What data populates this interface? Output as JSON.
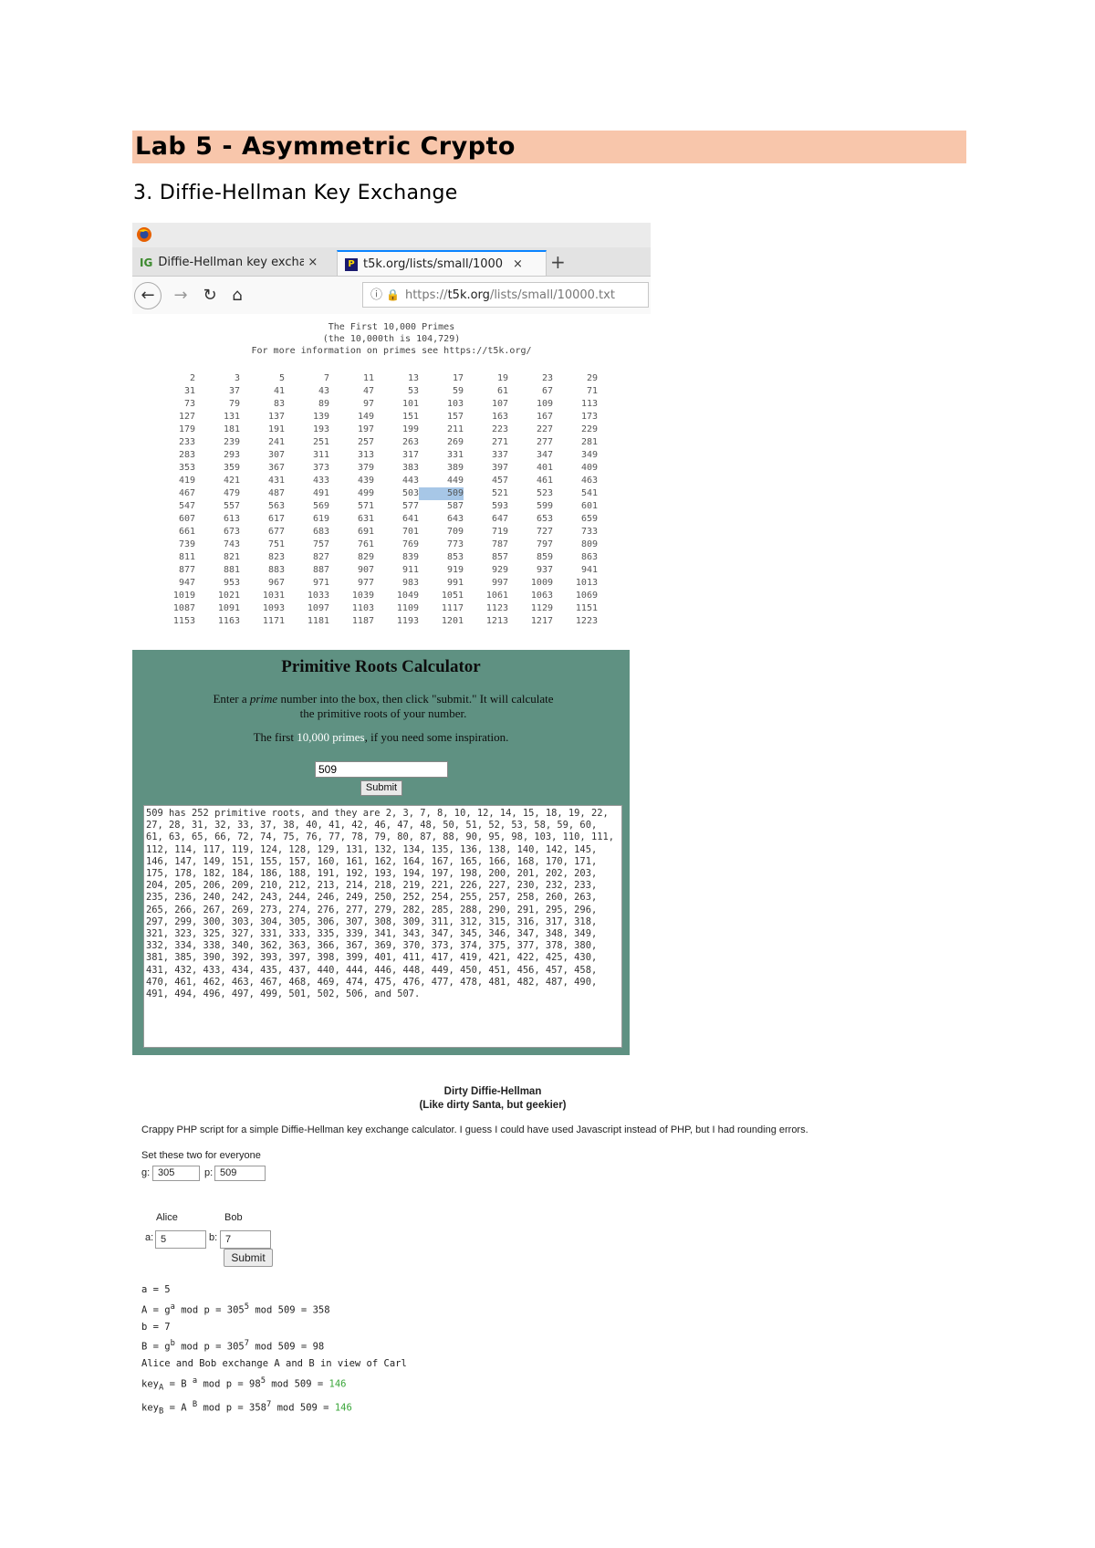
{
  "document": {
    "title": "Lab 5 - Asymmetric Crypto",
    "section": "3. Diffie-Hellman Key Exchange"
  },
  "browser": {
    "tabs": [
      {
        "label": "Diffie-Hellman key excha",
        "favicon": "IG",
        "active": false
      },
      {
        "label": "t5k.org/lists/small/1000",
        "favicon": "P",
        "active": true
      }
    ],
    "close_glyph": "×",
    "new_tab_glyph": "+",
    "url": {
      "prefix": "https://",
      "host": "t5k.org",
      "path": "/lists/small/10000.txt"
    }
  },
  "primes_page": {
    "line1": "The First 10,000 Primes",
    "line2": "(the 10,000th is 104,729)",
    "line3": "For more information on primes see https://t5k.org/",
    "rows": [
      [
        "2",
        "3",
        "5",
        "7",
        "11",
        "13",
        "17",
        "19",
        "23",
        "29"
      ],
      [
        "31",
        "37",
        "41",
        "43",
        "47",
        "53",
        "59",
        "61",
        "67",
        "71"
      ],
      [
        "73",
        "79",
        "83",
        "89",
        "97",
        "101",
        "103",
        "107",
        "109",
        "113"
      ],
      [
        "127",
        "131",
        "137",
        "139",
        "149",
        "151",
        "157",
        "163",
        "167",
        "173"
      ],
      [
        "179",
        "181",
        "191",
        "193",
        "197",
        "199",
        "211",
        "223",
        "227",
        "229"
      ],
      [
        "233",
        "239",
        "241",
        "251",
        "257",
        "263",
        "269",
        "271",
        "277",
        "281"
      ],
      [
        "283",
        "293",
        "307",
        "311",
        "313",
        "317",
        "331",
        "337",
        "347",
        "349"
      ],
      [
        "353",
        "359",
        "367",
        "373",
        "379",
        "383",
        "389",
        "397",
        "401",
        "409"
      ],
      [
        "419",
        "421",
        "431",
        "433",
        "439",
        "443",
        "449",
        "457",
        "461",
        "463"
      ],
      [
        "467",
        "479",
        "487",
        "491",
        "499",
        "503",
        "509",
        "521",
        "523",
        "541"
      ],
      [
        "547",
        "557",
        "563",
        "569",
        "571",
        "577",
        "587",
        "593",
        "599",
        "601"
      ],
      [
        "607",
        "613",
        "617",
        "619",
        "631",
        "641",
        "643",
        "647",
        "653",
        "659"
      ],
      [
        "661",
        "673",
        "677",
        "683",
        "691",
        "701",
        "709",
        "719",
        "727",
        "733"
      ],
      [
        "739",
        "743",
        "751",
        "757",
        "761",
        "769",
        "773",
        "787",
        "797",
        "809"
      ],
      [
        "811",
        "821",
        "823",
        "827",
        "829",
        "839",
        "853",
        "857",
        "859",
        "863"
      ],
      [
        "877",
        "881",
        "883",
        "887",
        "907",
        "911",
        "919",
        "929",
        "937",
        "941"
      ],
      [
        "947",
        "953",
        "967",
        "971",
        "977",
        "983",
        "991",
        "997",
        "1009",
        "1013"
      ],
      [
        "1019",
        "1021",
        "1031",
        "1033",
        "1039",
        "1049",
        "1051",
        "1061",
        "1063",
        "1069"
      ],
      [
        "1087",
        "1091",
        "1093",
        "1097",
        "1103",
        "1109",
        "1117",
        "1123",
        "1129",
        "1151"
      ],
      [
        "1153",
        "1163",
        "1171",
        "1181",
        "1187",
        "1193",
        "1201",
        "1213",
        "1217",
        "1223"
      ]
    ],
    "highlighted": "509"
  },
  "calculator": {
    "heading": "Primitive Roots Calculator",
    "desc_a": "Enter a ",
    "desc_em": "prime",
    "desc_b": " number into the box, then click \"submit.\" It will calculate the primitive roots of your number.",
    "inspire_a": "The first ",
    "inspire_link": "10,000 primes",
    "inspire_b": ", if you need some inspiration.",
    "input_value": "509",
    "submit_label": "Submit",
    "output": "509 has 252 primitive roots, and they are 2, 3, 7, 8, 10, 12, 14, 15, 18, 19, 22, 27, 28, 31, 32, 33, 37, 38, 40, 41, 42, 46, 47, 48, 50, 51, 52, 53, 58, 59, 60, 61, 63, 65, 66, 72, 74, 75, 76, 77, 78, 79, 80, 87, 88, 90, 95, 98, 103, 110, 111, 112, 114, 117, 119, 124, 128, 129, 131, 132, 134, 135, 136, 138, 140, 142, 145, 146, 147, 149, 151, 155, 157, 160, 161, 162, 164, 167, 165, 166, 168, 170, 171, 175, 178, 182, 184, 186, 188, 191, 192, 193, 194, 197, 198, 200, 201, 202, 203, 204, 205, 206, 209, 210, 212, 213, 214, 218, 219, 221, 226, 227, 230, 232, 233, 235, 236, 240, 242, 243, 244, 246, 249, 250, 252, 254, 255, 257, 258, 260, 263, 265, 266, 267, 269, 273, 274, 276, 277, 279, 282, 285, 288, 290, 291, 295, 296, 297, 299, 300, 303, 304, 305, 306, 307, 308, 309, 311, 312, 315, 316, 317, 318, 321, 323, 325, 327, 331, 333, 335, 339, 341, 343, 347, 345, 346, 347, 348, 349, 332, 334, 338, 340, 362, 363, 366, 367, 369, 370, 373, 374, 375, 377, 378, 380, 381, 385, 390, 392, 393, 397, 398, 399, 401, 411, 417, 419, 421, 422, 425, 430, 431, 432, 433, 434, 435, 437, 440, 444, 446, 448, 449, 450, 451, 456, 457, 458, 470, 461, 462, 463, 467, 468, 469, 474, 475, 476, 477, 478, 481, 482, 487, 490, 491, 494, 496, 497, 499, 501, 502, 506, and 507."
  },
  "dirty_dh": {
    "heading1": "Dirty Diffie-Hellman",
    "heading2": "(Like dirty Santa, but geekier)",
    "intro": "Crappy PHP script for a simple Diffie-Hellman key exchange calculator. I guess I could have used Javascript instead of PHP, but I had rounding errors.",
    "set_label": "Set these two for everyone",
    "g_label": "g:",
    "g_value": "305",
    "p_label": "p:",
    "p_value": "509",
    "alice_label": "Alice",
    "bob_label": "Bob",
    "a_label": "a:",
    "a_value": "5",
    "b_label": "b:",
    "b_value": "7",
    "submit_label": "Submit",
    "lines": {
      "l1": "a = 5",
      "l2a": "A = g",
      "l2sup": "a",
      "l2b": " mod p = 305",
      "l2sup2": "5",
      "l2c": " mod 509 = 358",
      "l3": "b = 7",
      "l4a": "B = g",
      "l4sup": "b",
      "l4b": " mod p = 305",
      "l4sup2": "7",
      "l4c": " mod 509 = 98",
      "l5": "Alice and Bob exchange A and B in view of Carl",
      "l6a": "key",
      "l6sub": "A",
      "l6b": " = B ",
      "l6sup": "a",
      "l6c": " mod p = 98",
      "l6sup2": "5",
      "l6d": " mod 509 = ",
      "l6res": "146",
      "l7a": "key",
      "l7sub": "B",
      "l7b": " = A ",
      "l7sup": "B",
      "l7c": " mod p = 358",
      "l7sup2": "7",
      "l7d": " mod 509 = ",
      "l7res": "146"
    }
  }
}
